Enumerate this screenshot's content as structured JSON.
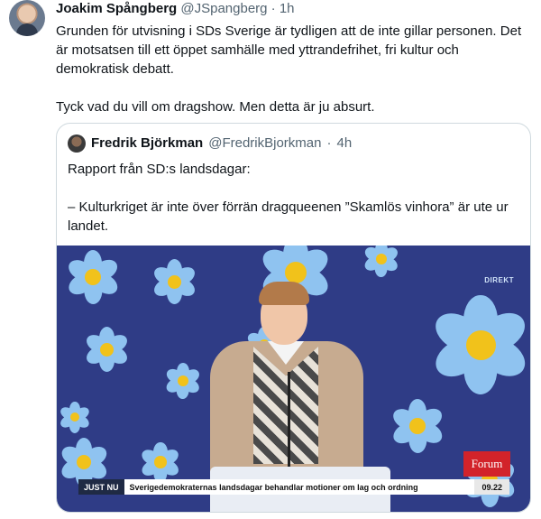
{
  "tweet": {
    "author_name": "Joakim Spångberg",
    "author_handle": "@JSpangberg",
    "separator": "·",
    "time": "1h",
    "paragraphs": [
      "Grunden för utvisning i SDs Sverige är tydligen att de inte gillar personen. Det är motsatsen till ett öppet samhälle med yttrandefrihet, fri kultur och demokratisk debatt.",
      "Tyck vad du vill om dragshow. Men detta är ju absurt."
    ]
  },
  "quoted": {
    "author_name": "Fredrik Björkman",
    "author_handle": "@FredrikBjorkman",
    "separator": "·",
    "time": "4h",
    "paragraphs": [
      "Rapport från SD:s landsdagar:",
      "– Kulturkriget är inte över förrän dragqueenen ”Skamlös vinhora” är ute ur landet."
    ]
  },
  "media": {
    "live_label": "DIREKT",
    "channel_badge": "Forum",
    "ticker_label": "JUST NU",
    "ticker_headline": "Sverigedemokraternas landsdagar behandlar motioner om lag och ordning",
    "ticker_time": "09.22",
    "colors": {
      "background": "#2f3c86",
      "petal": "#8fc3f0",
      "flower_center": "#f1c21b",
      "badge": "#d2232a"
    }
  }
}
